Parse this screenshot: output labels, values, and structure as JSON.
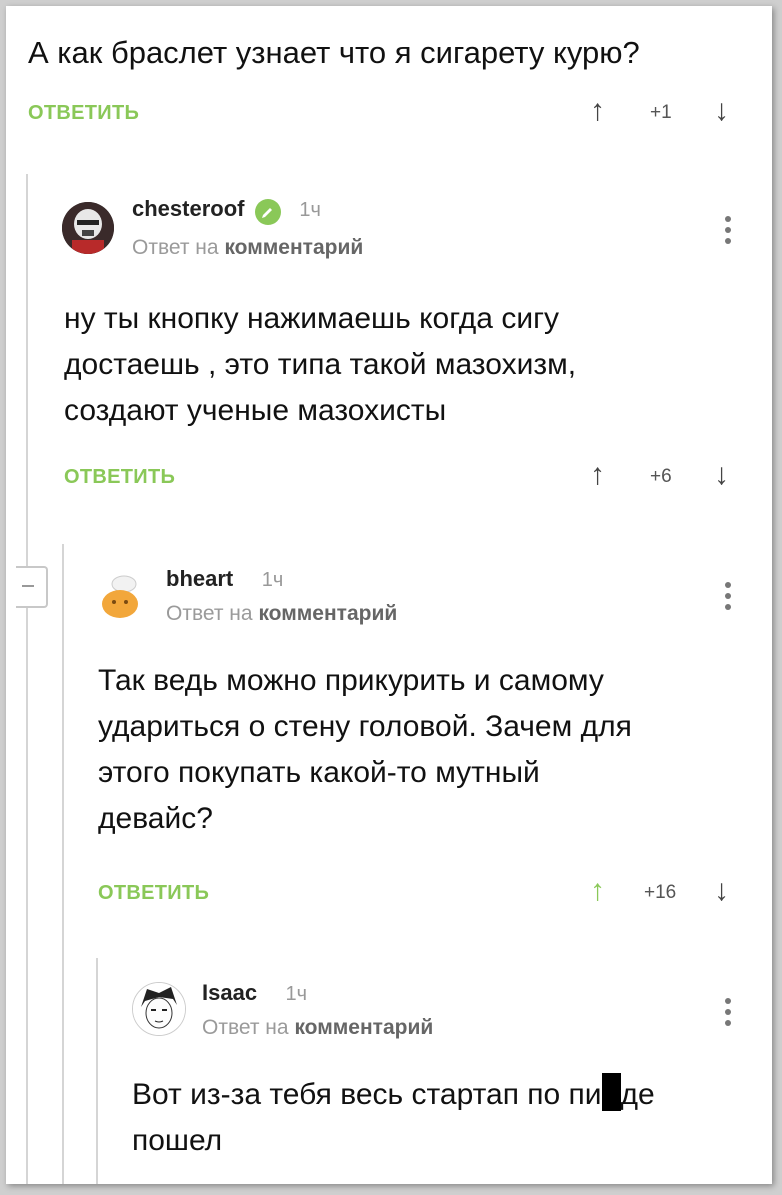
{
  "top_comment": {
    "text": "А как браслет узнает что я сигарету курю?",
    "reply_label": "ОТВЕТИТЬ",
    "rating": "+1"
  },
  "comments": [
    {
      "username": "chesteroof",
      "time": "1ч",
      "reply_to_prefix": "Ответ на",
      "reply_to_link": "комментарий",
      "lines": [
        "ну ты кнопку нажимаешь когда сигу",
        "достаешь , это типа такой мазохизм,",
        "создают ученые мазохисты"
      ],
      "reply_label": "ОТВЕТИТЬ",
      "rating": "+6",
      "avatar": "stormtrooper-avatar"
    },
    {
      "username": "bheart",
      "time": "1ч",
      "reply_to_prefix": "Ответ на",
      "reply_to_link": "комментарий",
      "lines": [
        "Так ведь можно прикурить и самому",
        "удариться о стену головой. Зачем для",
        "этого покупать какой-то мутный",
        "девайс?"
      ],
      "reply_label": "ОТВЕТИТЬ",
      "rating": "+16",
      "avatar": "chef-avatar"
    },
    {
      "username": "Isaac",
      "time": "1ч",
      "reply_to_prefix": "Ответ на",
      "reply_to_link": "комментарий",
      "line1_before": "Вот из-за тебя весь стартап по пи",
      "line1_after": "де",
      "line2": "пошел",
      "avatar": "anime-avatar"
    }
  ],
  "icons": {
    "up": "arrow-up-icon",
    "down": "arrow-down-icon",
    "more": "kebab-menu-icon",
    "verified": "verified-check-icon",
    "collapse": "collapse-thread-icon"
  },
  "colors": {
    "accent_green": "#8ac858",
    "text": "#111111",
    "muted": "#9a9a9a"
  }
}
